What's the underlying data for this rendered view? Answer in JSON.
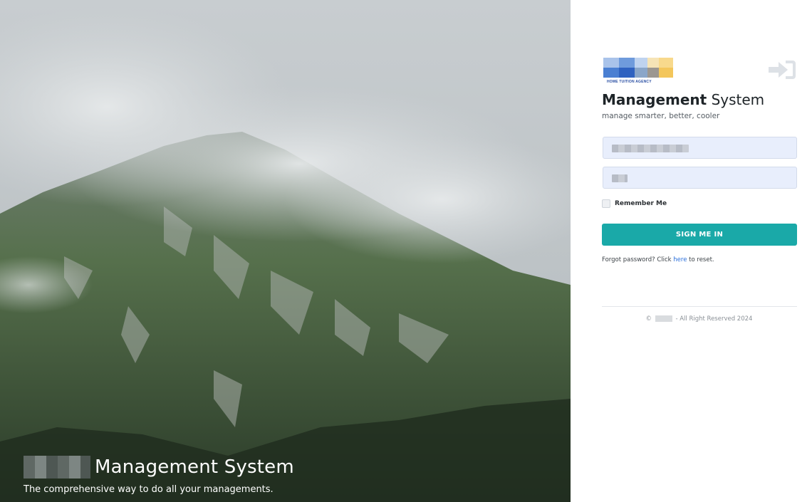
{
  "hero": {
    "title": "Management System",
    "subtitle": "The comprehensive way to do all your managements."
  },
  "panel": {
    "logo_text": "HOME TUITION AGENCY",
    "title_bold": "Management",
    "title_light": "System",
    "tagline": "manage smarter, better, cooler",
    "login_icon": "sign-in-icon"
  },
  "form": {
    "email_value": "",
    "password_value": "",
    "remember_label": "Remember Me",
    "submit_label": "SIGN ME IN",
    "forgot_prefix": "Forgot password? Click ",
    "forgot_link": "here",
    "forgot_suffix": " to reset."
  },
  "footer": {
    "copyright_symbol": "©",
    "text": "- All Right Reserved 2024"
  },
  "colors": {
    "accent": "#1aa9a8",
    "link": "#2a6fdb",
    "input_bg": "#e8eefc"
  }
}
